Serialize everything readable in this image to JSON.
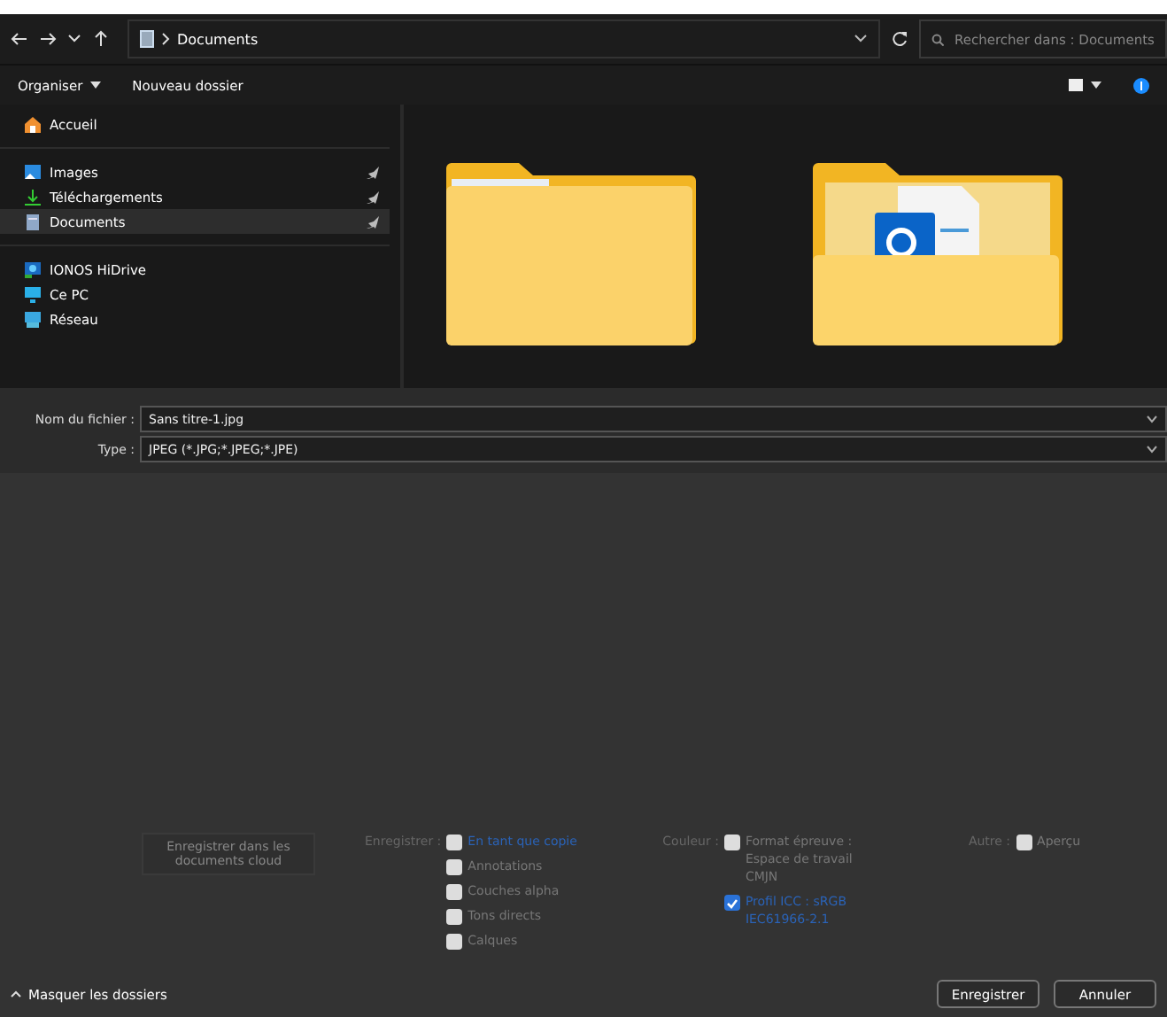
{
  "address_bar": {
    "path": "Documents",
    "search_placeholder": "Rechercher dans : Documents"
  },
  "toolbar": {
    "organize": "Organiser",
    "new_folder": "Nouveau dossier"
  },
  "sidebar": {
    "groups": [
      [
        {
          "label": "Accueil",
          "kind": "home",
          "pinned": false,
          "selected": false
        }
      ],
      [
        {
          "label": "Images",
          "kind": "images",
          "pinned": true,
          "selected": false
        },
        {
          "label": "Téléchargements",
          "kind": "download",
          "pinned": true,
          "selected": false
        },
        {
          "label": "Documents",
          "kind": "document",
          "pinned": true,
          "selected": true
        }
      ],
      [
        {
          "label": "IONOS HiDrive",
          "kind": "cloud",
          "pinned": false,
          "selected": false
        },
        {
          "label": "Ce PC",
          "kind": "pc",
          "pinned": false,
          "selected": false
        },
        {
          "label": "Réseau",
          "kind": "network",
          "pinned": false,
          "selected": false
        }
      ]
    ]
  },
  "folders": [
    {
      "kind": "plain"
    },
    {
      "kind": "outlook"
    }
  ],
  "fields": [
    {
      "label": "Nom du fichier :",
      "value": "Sans titre-1.jpg"
    },
    {
      "label": "Type :",
      "value": "JPEG (*.JPG;*.JPEG;*.JPE)"
    }
  ],
  "cloud_button": "Enregistrer dans les documents cloud",
  "option_groups": [
    {
      "label": "Enregistrer :",
      "options": [
        {
          "label": "En tant que copie",
          "checked": false,
          "accent": true
        },
        {
          "label": "Annotations",
          "checked": false,
          "accent": false
        },
        {
          "label": "Couches alpha",
          "checked": false,
          "accent": false
        },
        {
          "label": "Tons directs",
          "checked": false,
          "accent": false
        },
        {
          "label": "Calques",
          "checked": false,
          "accent": false
        }
      ]
    },
    {
      "label": "Couleur :",
      "options": [
        {
          "label": "Format épreuve : Espace de travail CMJN",
          "checked": false,
          "accent": false
        },
        {
          "label": "Profil ICC : sRGB IEC61966-2.1",
          "checked": true,
          "accent": true
        }
      ]
    },
    {
      "label": "Autre :",
      "options": [
        {
          "label": "Aperçu",
          "checked": false,
          "accent": false
        }
      ]
    }
  ],
  "hide_folders": "Masquer les dossiers",
  "buttons": [
    "Enregistrer",
    "Annuler"
  ]
}
